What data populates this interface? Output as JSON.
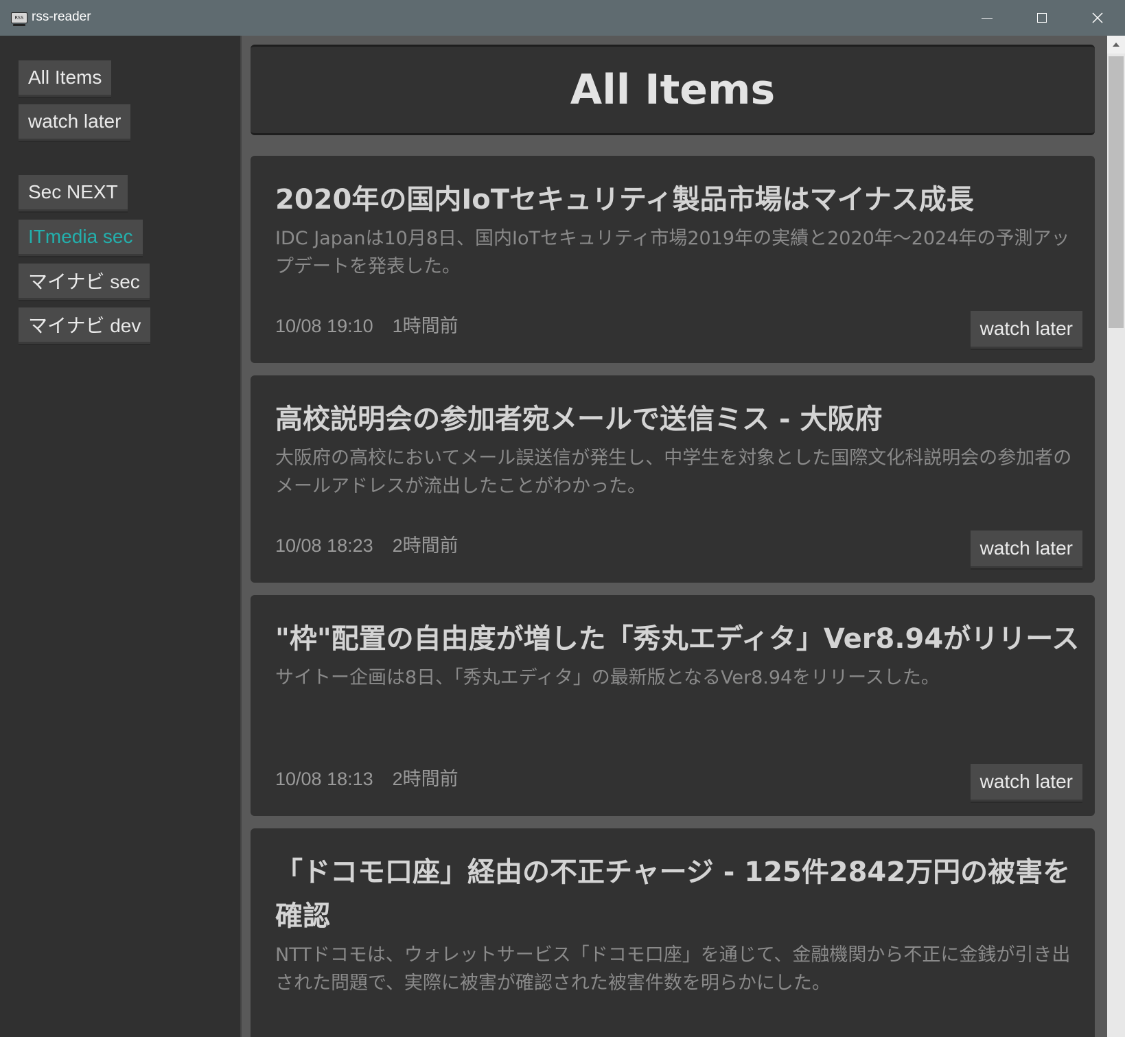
{
  "window": {
    "title": "rss-reader",
    "icon_text": "RSS",
    "icons": [
      "rss-app-icon",
      "minimize-icon",
      "maximize-icon",
      "close-icon"
    ]
  },
  "sidebar": {
    "items": [
      {
        "label": "All Items"
      },
      {
        "label": "watch later"
      },
      {
        "label": "Sec NEXT"
      },
      {
        "label": "ITmedia sec",
        "active": true
      },
      {
        "label": "マイナビ sec"
      },
      {
        "label": "マイナビ dev"
      }
    ]
  },
  "main": {
    "title": "All Items",
    "articles": [
      {
        "title": "2020年の国内IoTセキュリティ製品市場はマイナス成長",
        "description": "IDC Japanは10月8日、国内IoTセキュリティ市場2019年の実績と2020年～2024年の予測アップデートを発表した。",
        "date": "10/08 19:10",
        "relative": "1時間前",
        "button": "watch later"
      },
      {
        "title": "高校説明会の参加者宛メールで送信ミス - 大阪府",
        "description": "大阪府の高校においてメール誤送信が発生し、中学生を対象とした国際文化科説明会の参加者のメールアドレスが流出したことがわかった。",
        "date": "10/08 18:23",
        "relative": "2時間前",
        "button": "watch later"
      },
      {
        "title": "\"枠\"配置の自由度が増した「秀丸エディタ」Ver8.94がリリース",
        "description": "サイトー企画は8日、「秀丸エディタ」の最新版となるVer8.94をリリースした。",
        "date": "10/08 18:13",
        "relative": "2時間前",
        "button": "watch later"
      },
      {
        "title": "「ドコモ口座」経由の不正チャージ - 125件2842万円の被害を確認",
        "description": "NTTドコモは、ウォレットサービス「ドコモ口座」を通じて、金融機関から不正に金銭が引き出された問題で、実際に被害が確認された被害件数を明らかにした。"
      }
    ]
  },
  "colors": {
    "titlebar": "#5f6b70",
    "sidebar_bg": "#303030",
    "main_bg": "#595959",
    "card_bg": "#323232",
    "accent": "#23b0ad"
  }
}
